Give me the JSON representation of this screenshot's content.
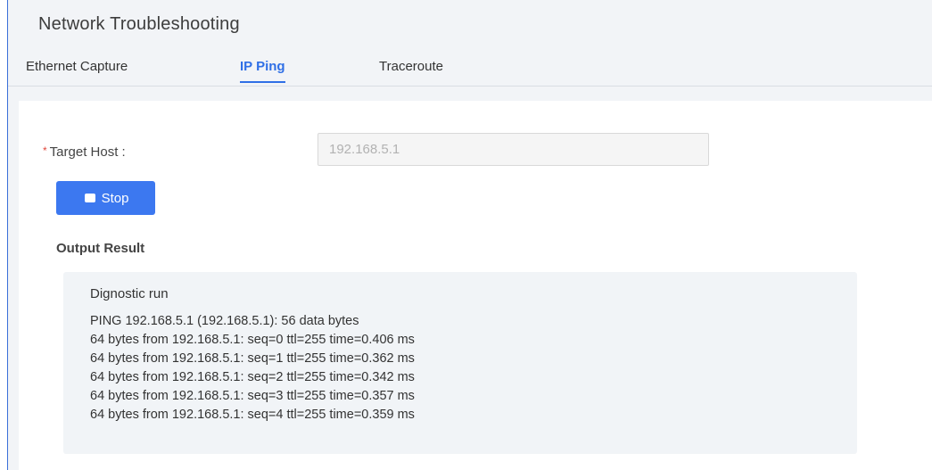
{
  "header": {
    "title": "Network Troubleshooting"
  },
  "tabs": [
    {
      "label": "Ethernet Capture",
      "active": false
    },
    {
      "label": "IP Ping",
      "active": true
    },
    {
      "label": "Traceroute",
      "active": false
    }
  ],
  "form": {
    "required_marker": "*",
    "target_host_label": "Target Host :",
    "target_host_value": "192.168.5.1",
    "stop_button_label": "Stop"
  },
  "output": {
    "section_title": "Output Result",
    "heading": "Dignostic run",
    "lines": [
      "PING 192.168.5.1 (192.168.5.1): 56 data bytes",
      "64 bytes from 192.168.5.1: seq=0 ttl=255 time=0.406 ms",
      "64 bytes from 192.168.5.1: seq=1 ttl=255 time=0.362 ms",
      "64 bytes from 192.168.5.1: seq=2 ttl=255 time=0.342 ms",
      "64 bytes from 192.168.5.1: seq=3 ttl=255 time=0.357 ms",
      "64 bytes from 192.168.5.1: seq=4 ttl=255 time=0.359 ms"
    ]
  },
  "icons": {
    "stop_button_icon": "stop-icon"
  },
  "colors": {
    "accent": "#3c78f0",
    "active_tab": "#2f6fe6",
    "required": "#e0473c"
  }
}
